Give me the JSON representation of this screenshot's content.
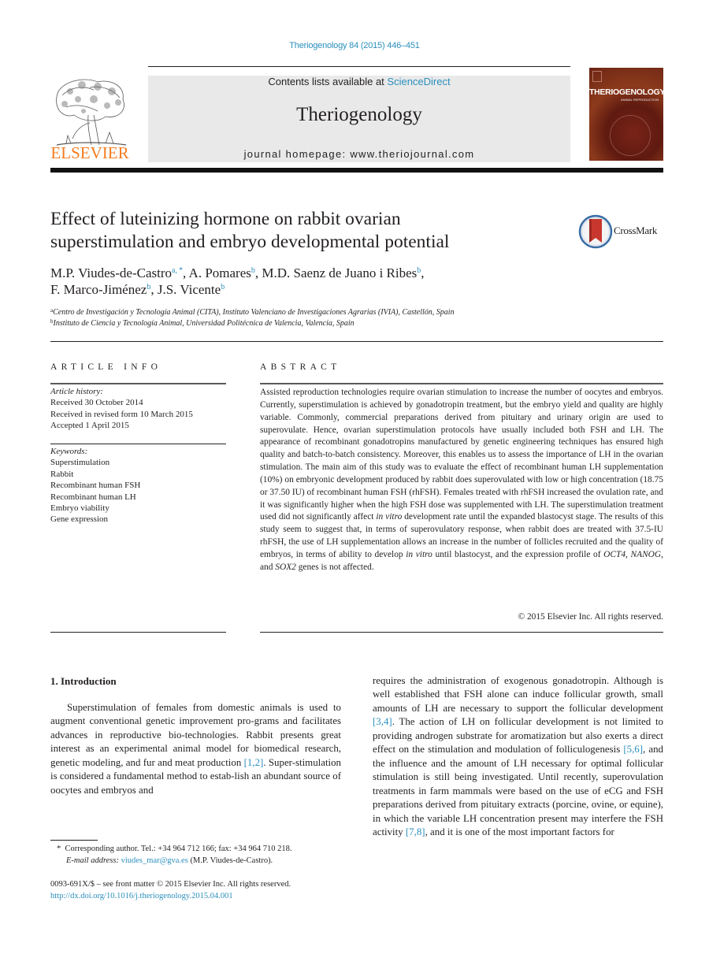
{
  "header": {
    "citation": "Theriogenology 84 (2015) 446–451",
    "publisher_logo_text": "ELSEVIER",
    "contents_prefix": "Contents lists available at ",
    "contents_link": "ScienceDirect",
    "journal_name": "Theriogenology",
    "homepage_prefix": "journal homepage: ",
    "homepage_url": "www.theriojournal.com",
    "cover_title": "THERIOGENOLOGY",
    "cover_subtitle": "ANIMAL REPRODUCTION"
  },
  "colors": {
    "link": "#2a8fbd",
    "elsevier_orange": "#f47b20",
    "masthead_bg": "#e9e9e9",
    "crossmark_red": "#c8372d",
    "crossmark_blue": "#3a6ea5"
  },
  "article": {
    "title_line1": "Effect of luteinizing hormone on rabbit ovarian",
    "title_line2": "superstimulation and embryo developmental potential",
    "crossmark_label": "CrossMark",
    "authors": [
      {
        "name": "M.P. Viudes-de-Castro",
        "aff": "a, *",
        "sep": ", "
      },
      {
        "name": "A. Pomares",
        "aff": "b",
        "sep": ", "
      },
      {
        "name": "M.D. Saenz de Juano i Ribes",
        "aff": "b",
        "sep": ","
      },
      {
        "name": "F. Marco-Jiménez",
        "aff": "b",
        "sep": ", "
      },
      {
        "name": "J.S. Vicente",
        "aff": "b",
        "sep": ""
      }
    ],
    "affiliations": [
      {
        "mark": "a",
        "text": "Centro de Investigación y Tecnología Animal (CITA), Instituto Valenciano de Investigaciones Agrarias (IVIA), Castellón, Spain"
      },
      {
        "mark": "b",
        "text": "Instituto de Ciencia y Tecnología Animal, Universidad Politécnica de Valencia, Valencia, Spain"
      }
    ]
  },
  "article_info": {
    "heading": "ARTICLE INFO",
    "history_label": "Article history:",
    "history": [
      "Received 30 October 2014",
      "Received in revised form 10 March 2015",
      "Accepted 1 April 2015"
    ],
    "keywords_label": "Keywords:",
    "keywords": [
      "Superstimulation",
      "Rabbit",
      "Recombinant human FSH",
      "Recombinant human LH",
      "Embryo viability",
      "Gene expression"
    ]
  },
  "abstract": {
    "heading": "ABSTRACT",
    "p1": "Assisted reproduction technologies require ovarian stimulation to increase the number of oocytes and embryos. Currently, superstimulation is achieved by gonadotropin treatment, but the embryo yield and quality are highly variable. Commonly, commercial preparations derived from pituitary and urinary origin are used to superovulate. Hence, ovarian superstimulation protocols have usually included both FSH and LH. The appearance of recombinant gonadotropins manufactured by genetic engineering techniques has ensured high quality and batch-to-batch consistency. Moreover, this enables us to assess the importance of LH in the ovarian stimulation. The main aim of this study was to evaluate the effect of recombinant human LH supplementation (10%) on embryonic development produced by rabbit does superovulated with low or high concentration (18.75 or 37.50 IU) of recombinant human FSH (rhFSH). Females treated with rhFSH increased the ovulation rate, and it was significantly higher when the high FSH dose was supplemented with LH. The superstimulation treatment used did not significantly affect ",
    "italic1": "in vitro",
    "p2": " development rate until the expanded blastocyst stage. The results of this study seem to suggest that, in terms of superovulatory response, when rabbit does are treated with 37.5-IU rhFSH, the use of LH supplementation allows an increase in the number of follicles recruited and the quality of embryos, in terms of ability to develop ",
    "italic2": "in vitro",
    "p3": " until blastocyst, and the expression profile of ",
    "gene1": "OCT4",
    "sep1": ", ",
    "gene2": "NANOG",
    "sep2": ", and ",
    "gene3": "SOX2",
    "p4": " genes is not affected.",
    "copyright": "© 2015 Elsevier Inc. All rights reserved."
  },
  "body": {
    "section_heading": "1.  Introduction",
    "left_a": "Superstimulation of females from domestic animals is used to augment conventional genetic improvement pro-grams and facilitates advances in reproductive bio-technologies. Rabbit presents great interest as an experimental animal model for biomedical research, genetic modeling, and fur and meat production ",
    "ref1": "[1,2]",
    "left_b": ". Super-stimulation is considered a fundamental method to estab-lish an abundant source of oocytes and embryos and",
    "right_a": "requires the administration of exogenous gonadotropin. Although is well established that FSH alone can induce follicular growth, small amounts of LH are necessary to support the follicular development ",
    "ref2": "[3,4]",
    "right_b": ". The action of LH on follicular development is not limited to providing androgen substrate for aromatization but also exerts a direct effect on the stimulation and modulation of folliculogenesis ",
    "ref3": "[5,6]",
    "right_c": ", and the influence and the amount of LH necessary for optimal follicular stimulation is still being investigated. Until recently, superovulation treatments in farm mammals were based on the use of eCG and FSH preparations derived from pituitary extracts (porcine, ovine, or equine), in which the variable LH concentration present may interfere the FSH activity ",
    "ref4": "[7,8]",
    "right_d": ", and it is one of the most important factors for"
  },
  "footnotes": {
    "corr_mark": "*",
    "corr_text": "Corresponding author. Tel.: +34 964 712 166; fax: +34 964 710 218.",
    "email_label": "E-mail address:",
    "email": "viudes_mar@gva.es",
    "email_suffix": " (M.P. Viudes-de-Castro).",
    "front_matter": "0093-691X/$ – see front matter © 2015 Elsevier Inc. All rights reserved.",
    "doi": "http://dx.doi.org/10.1016/j.theriogenology.2015.04.001"
  }
}
